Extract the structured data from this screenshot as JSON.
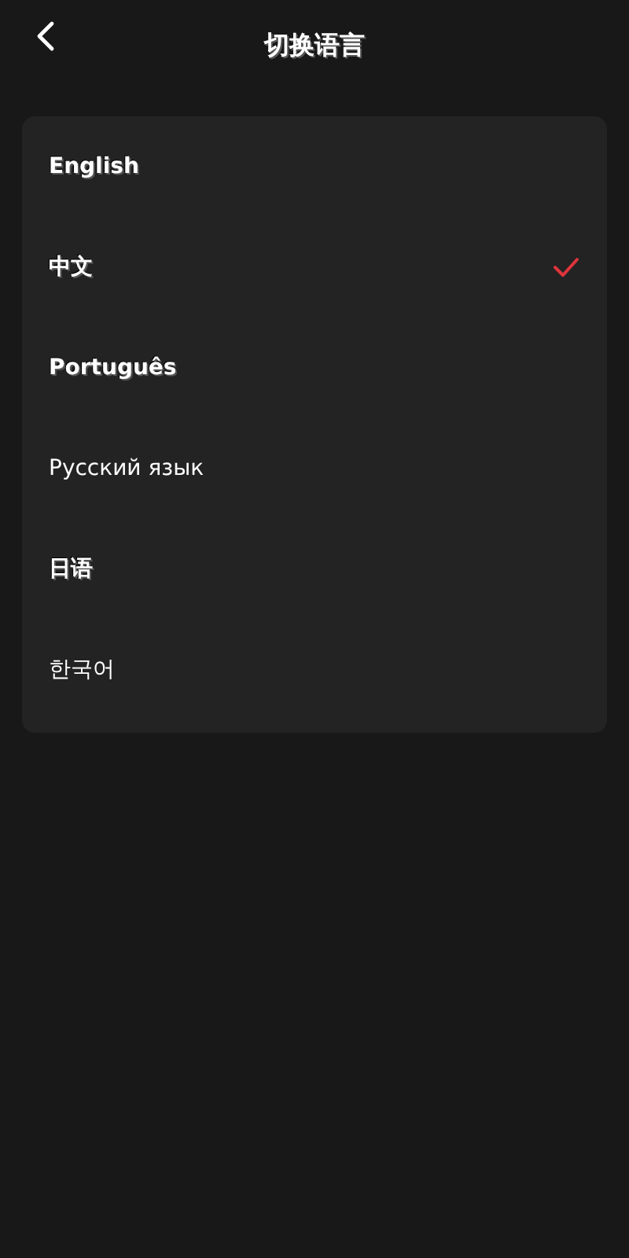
{
  "header": {
    "title": "切换语言"
  },
  "languages": [
    {
      "label": "English",
      "kind": "display",
      "selected": false
    },
    {
      "label": "中文",
      "kind": "display",
      "selected": true
    },
    {
      "label": "Português",
      "kind": "display",
      "selected": false
    },
    {
      "label": "Русский язык",
      "kind": "plain",
      "selected": false
    },
    {
      "label": "日语",
      "kind": "display",
      "selected": false
    },
    {
      "label": "한국어",
      "kind": "plain",
      "selected": false
    }
  ]
}
